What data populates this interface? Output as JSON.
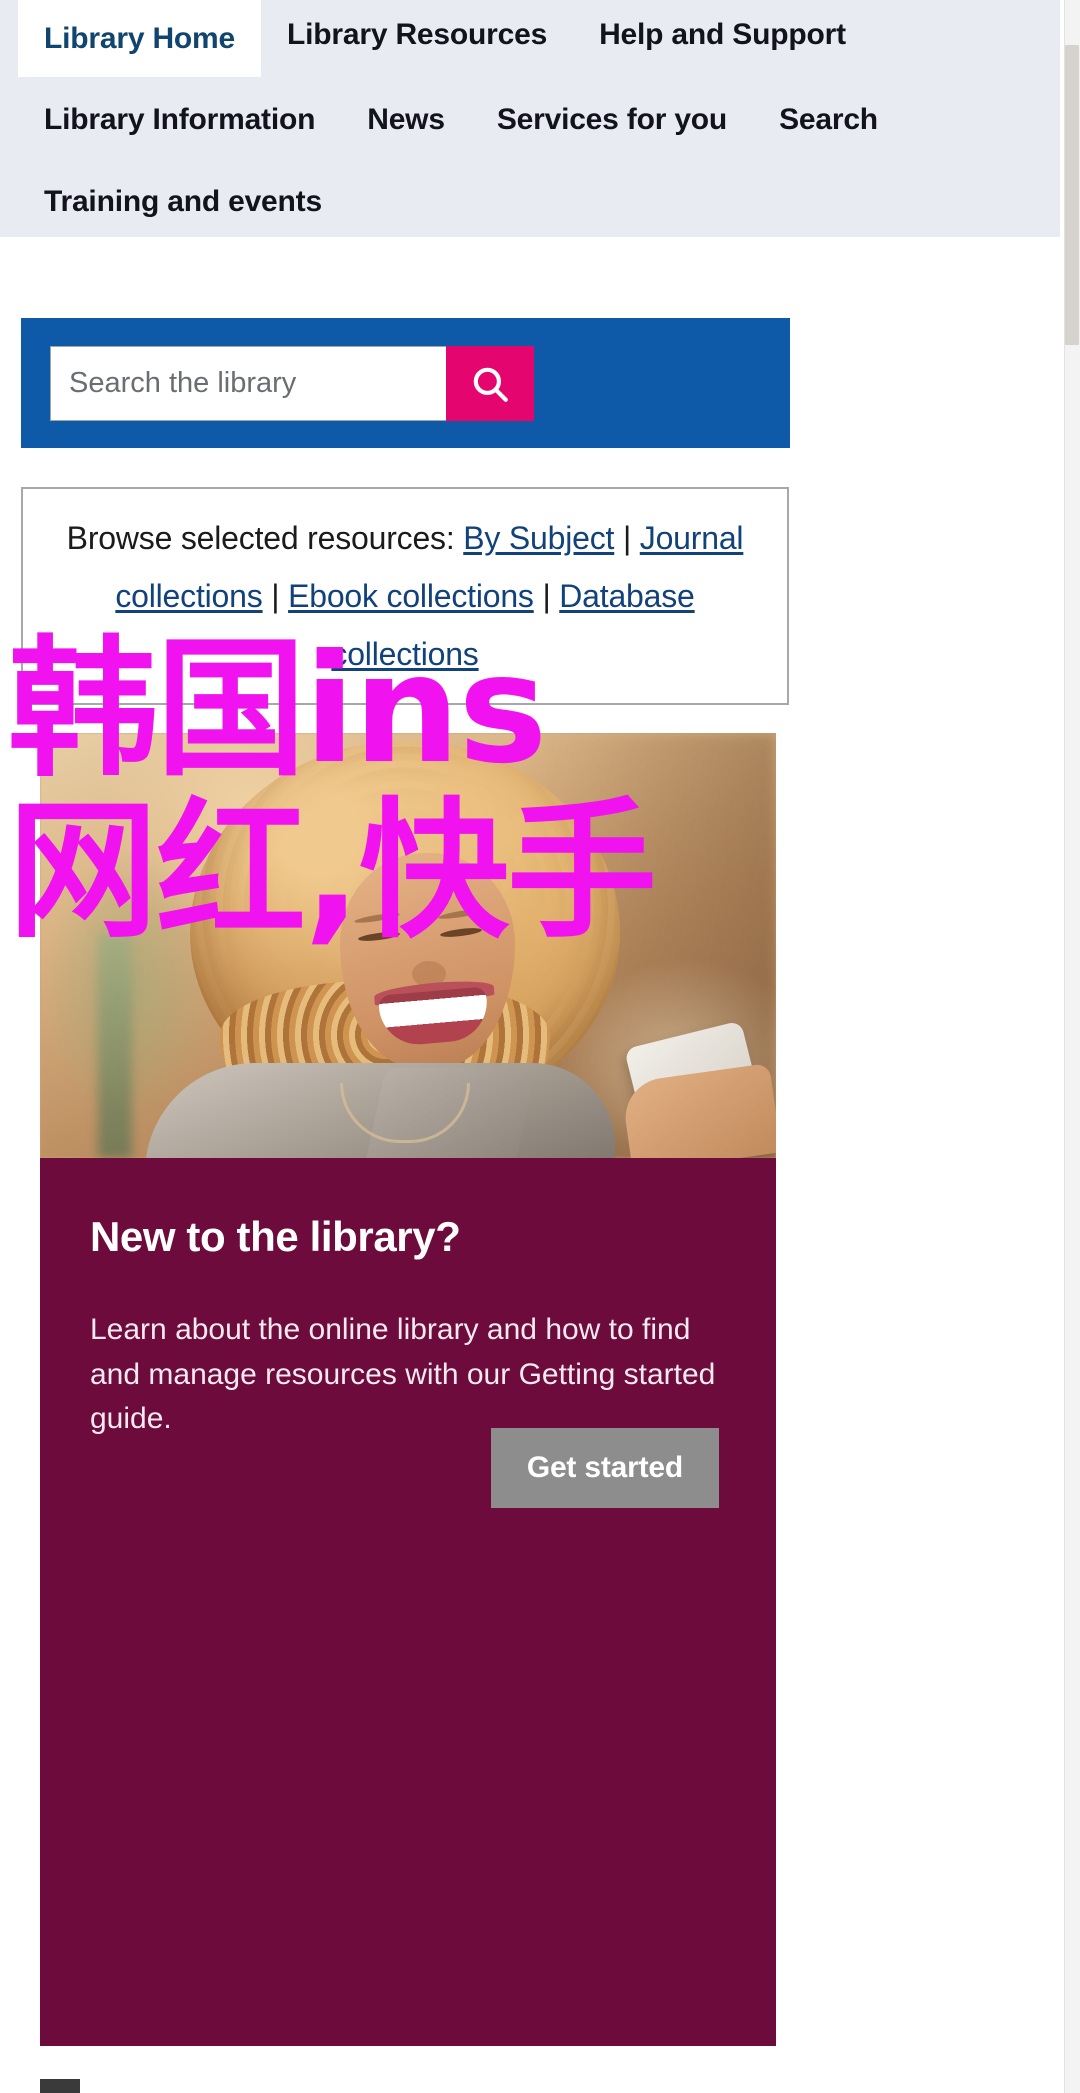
{
  "nav": {
    "rows": [
      [
        {
          "label": "Library Home",
          "active": true
        },
        {
          "label": "Library Resources",
          "active": false
        },
        {
          "label": "Help and Support",
          "active": false
        }
      ],
      [
        {
          "label": "Library Information",
          "active": false
        },
        {
          "label": "News",
          "active": false
        },
        {
          "label": "Services for you",
          "active": false
        },
        {
          "label": "Search",
          "active": false
        }
      ],
      [
        {
          "label": "Training and events",
          "active": false
        }
      ]
    ]
  },
  "search": {
    "placeholder": "Search the library",
    "value": "",
    "button_icon": "search-icon",
    "panel_color": "#0f5aa8",
    "button_color": "#e5056e"
  },
  "browse": {
    "label": "Browse selected resources:",
    "separator": "|",
    "links": [
      "By Subject",
      "Journal collections",
      "Ebook collections",
      "Database collections"
    ]
  },
  "promo": {
    "title": "New to the library?",
    "body": "Learn about the online library and how to find and manage resources with our Getting started guide.",
    "cta_label": "Get started",
    "panel_color": "#6c0b3c",
    "cta_color": "#8d8d8d"
  },
  "overlay": {
    "line1": "韩国ins",
    "line2": "网红,快手",
    "color": "#f013f0"
  }
}
